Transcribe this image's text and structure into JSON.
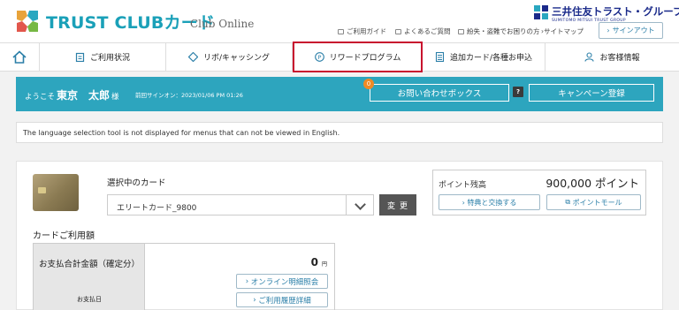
{
  "header": {
    "logo_text": "TRUST CLUBカード",
    "logo_sub": "Club Online",
    "corp_name": "三井住友トラスト・グループ",
    "corp_en": "SUMITOMO MITSUI TRUST GROUP",
    "util_links": [
      {
        "label": "ご利用ガイド"
      },
      {
        "label": "よくあるご質問"
      },
      {
        "label": "紛失・盗難でお困りの方"
      },
      {
        "label": "サイトマップ"
      }
    ],
    "signout_label": "サインアウト"
  },
  "nav": {
    "home_icon": "home-icon",
    "items": [
      {
        "label": "ご利用状況",
        "icon": "clipboard-icon"
      },
      {
        "label": "リボ/キャッシング",
        "icon": "diamond-arrows-icon"
      },
      {
        "label": "リワードプログラム",
        "icon": "p-circle-icon"
      },
      {
        "label": "追加カード/各種お申込",
        "icon": "document-icon"
      },
      {
        "label": "お客様情報",
        "icon": "person-icon"
      }
    ],
    "active_index": 2,
    "highlight_color": "#c8102e"
  },
  "welcome": {
    "prefix": "ようこそ",
    "name": "東京　太郎",
    "suffix": "様",
    "last_signin": "前回サインオン：2023/01/06 PM 01:26",
    "inquiry_label": "お問い合わせボックス",
    "inquiry_badge": "0",
    "help_label": "?",
    "campaign_label": "キャンペーン登録",
    "bar_color": "#2da5be"
  },
  "notice": {
    "text": "The language selection tool is not displayed for menus that can not be viewed in English."
  },
  "card": {
    "select_label": "選択中のカード",
    "selected_card": "エリートカード_9800",
    "change_label": "変更"
  },
  "points": {
    "label": "ポイント残高",
    "value": "900,000 ポイント",
    "exchange_label": "特典と交換する",
    "mall_label": "ポイントモール"
  },
  "usage": {
    "title": "カードご利用額",
    "total_label": "お支払合計金額（確定分）",
    "date_label": "お支払日",
    "amount": "0",
    "unit": "円",
    "statement_label": "オンライン明細照会",
    "history_label": "ご利用履歴詳細"
  }
}
